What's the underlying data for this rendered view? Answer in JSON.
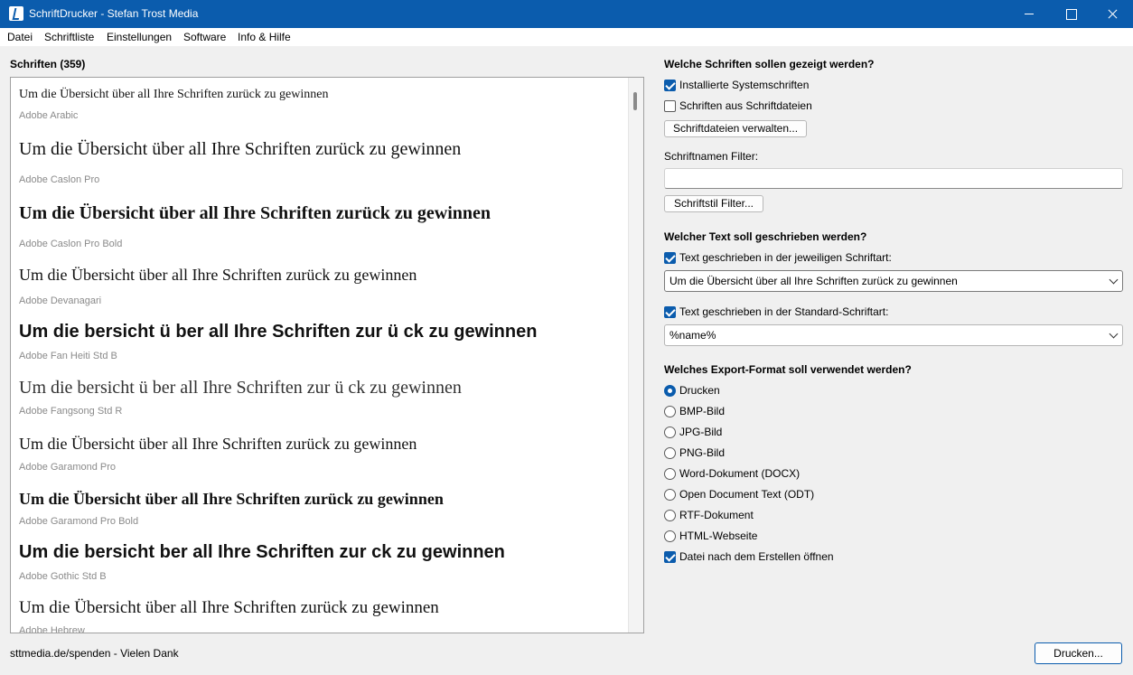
{
  "window": {
    "title": "SchriftDrucker - Stefan Trost Media"
  },
  "menu": [
    "Datei",
    "Schriftliste",
    "Einstellungen",
    "Software",
    "Info & Hilfe"
  ],
  "fonts_panel": {
    "heading": "Schriften (359)",
    "entries": [
      {
        "sample": "Um die Übersicht über all Ihre Schriften zurück zu gewinnen",
        "name": "Adobe Arabic"
      },
      {
        "sample": "Um die Übersicht über all Ihre Schriften zurück zu gewinnen",
        "name": "Adobe Caslon Pro"
      },
      {
        "sample": "Um die Übersicht über all Ihre Schriften zurück zu gewinnen",
        "name": "Adobe Caslon Pro Bold"
      },
      {
        "sample": "Um die Übersicht über all Ihre Schriften zurück zu gewinnen",
        "name": "Adobe Devanagari"
      },
      {
        "sample": "Um die  bersicht  ü ber all Ihre Schriften zur ü ck zu gewinnen",
        "name": "Adobe Fan Heiti Std B"
      },
      {
        "sample": "Um die  bersicht  ü ber all Ihre Schriften zur ü ck zu gewinnen",
        "name": "Adobe Fangsong Std R"
      },
      {
        "sample": "Um die Übersicht über all Ihre Schriften zurück zu gewinnen",
        "name": "Adobe Garamond Pro"
      },
      {
        "sample": "Um die Übersicht über all Ihre Schriften zurück zu gewinnen",
        "name": "Adobe Garamond Pro Bold"
      },
      {
        "sample": "Um die  bersicht  ber all Ihre Schriften zur ck zu gewinnen",
        "name": "Adobe Gothic Std B"
      },
      {
        "sample": "Um die Übersicht über all Ihre Schriften zurück zu gewinnen",
        "name": "Adobe Hebrew"
      }
    ]
  },
  "settings": {
    "which_fonts": {
      "heading": "Welche Schriften sollen gezeigt werden?",
      "installed_label": "Installierte Systemschriften",
      "installed_checked": true,
      "from_files_label": "Schriften aus Schriftdateien",
      "from_files_checked": false,
      "manage_button": "Schriftdateien verwalten...",
      "filter_label": "Schriftnamen Filter:",
      "filter_value": "",
      "style_filter_button": "Schriftstil Filter..."
    },
    "which_text": {
      "heading": "Welcher Text soll geschrieben werden?",
      "own_font_label": "Text geschrieben in der jeweiligen Schriftart:",
      "own_font_checked": true,
      "own_font_value": "Um die Übersicht über all Ihre Schriften zurück zu gewinnen",
      "std_font_label": "Text geschrieben in der Standard-Schriftart:",
      "std_font_checked": true,
      "std_font_value": "%name%"
    },
    "export": {
      "heading": "Welches Export-Format soll verwendet werden?",
      "options": [
        "Drucken",
        "BMP-Bild",
        "JPG-Bild",
        "PNG-Bild",
        "Word-Dokument (DOCX)",
        "Open Document Text (ODT)",
        "RTF-Dokument",
        "HTML-Webseite"
      ],
      "selected": "Drucken",
      "open_after_label": "Datei nach dem Erstellen öffnen",
      "open_after_checked": true
    }
  },
  "footer": {
    "text": "sttmedia.de/spenden - Vielen Dank",
    "print_button": "Drucken..."
  },
  "colors": {
    "titlebar": "#0b5cad",
    "accent": "#0b5cad"
  }
}
